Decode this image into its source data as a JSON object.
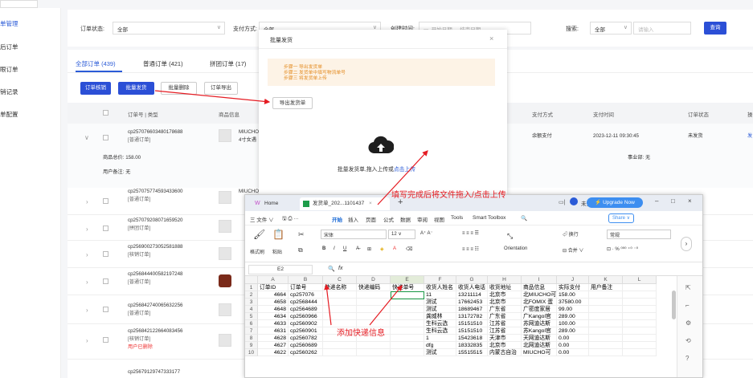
{
  "sidebar": {
    "items": [
      {
        "label": "单管理",
        "active": true
      },
      {
        "label": "后订单"
      },
      {
        "label": "眼订单"
      },
      {
        "label": "销记录"
      },
      {
        "label": "单配置"
      }
    ]
  },
  "filters": {
    "order_status_label": "订单状态:",
    "order_status_value": "全部",
    "pay_method_label": "支付方式:",
    "pay_method_value": "全部",
    "created_time_label": "创建时间:",
    "start_date_placeholder": "开始日期",
    "date_sep": "-",
    "end_date_placeholder": "结束日期",
    "search_label": "搜索:",
    "search_scope_value": "全部",
    "search_placeholder": "请输入",
    "query_button": "查询"
  },
  "tabs": [
    {
      "label": "全部订单 (439)",
      "active": true
    },
    {
      "label": "普通订单 (421)"
    },
    {
      "label": "拼团订单 (17)"
    }
  ],
  "actions": {
    "verify": "订单核销",
    "batch_ship": "批量发货",
    "batch_delete": "批量删除",
    "export": "订单导出"
  },
  "table": {
    "headers": [
      "订单号 | 类型",
      "商品信息",
      "支付方式",
      "支付时间",
      "订单状态",
      "操"
    ],
    "first_row": {
      "order_no": "cp257076603480178688",
      "type": "[普通订单]",
      "product": "MIUCHO",
      "product_sub": "4寸女遇",
      "pay_method": "余额支付",
      "pay_time": "2023-12-11 09:30:45",
      "status": "未发货",
      "op": "发"
    },
    "first_detail": {
      "total_label": "商品总价: 158.00",
      "remark_label": "用户备注: 无",
      "dept_label": "事业部: 无"
    },
    "rows": [
      {
        "order_no": "cp257075774593433600",
        "type": "[普通订单]",
        "product": "MIUCHO",
        "extra": ""
      },
      {
        "order_no": "cp257079208071659520",
        "type": "[拼团订单]",
        "product": "",
        "extra": ""
      },
      {
        "order_no": "cp256900273052581888",
        "type": "[核销订单]",
        "product": "",
        "extra": ""
      },
      {
        "order_no": "cp256844400582197248",
        "type": "[普通订单]",
        "product": "",
        "extra": ""
      },
      {
        "order_no": "cp256842740065632256",
        "type": "[普通订单]",
        "product": "",
        "extra": ""
      },
      {
        "order_no": "cp256842122664083456",
        "type": "[核销订单]",
        "product": "",
        "extra": "用户已删除"
      },
      {
        "order_no": "cp25679129747333177",
        "type": "",
        "product": "",
        "extra": ""
      }
    ]
  },
  "dialog": {
    "title": "批量发货",
    "steps": [
      "步骤一 导出发货单",
      "步骤二 发货单中填写物流单号",
      "步骤三 将发货单上传"
    ],
    "export_button": "导出发货单",
    "upload_text": "批量发货单,拖入上传或",
    "upload_link": "点击上传"
  },
  "annotations": {
    "fill_upload": "填写完成后将文件拖入/点击上传",
    "add_express": "添加快递信息"
  },
  "excel": {
    "home_tab": "Home",
    "file_tab": "发货单_202...1101437",
    "not_logged": "未登录",
    "upgrade": "Upgrade Now",
    "menus": [
      "三 文件 ∨",
      "开始",
      "插入",
      "页面",
      "公式",
      "数据",
      "审阅",
      "视图",
      "Tools",
      "Smart Toolbox"
    ],
    "share": "Share",
    "ribbon": {
      "format_painter": "格式刷",
      "paste": "粘贴",
      "font": "宋体",
      "font_size": "12",
      "wrap": "换行",
      "merge": "合并",
      "orientation": "Orientation",
      "number_format": "常规"
    },
    "name_box": "E2",
    "fx": "fx",
    "columns": [
      "A",
      "B",
      "C",
      "D",
      "E",
      "F",
      "G",
      "H",
      "I",
      "J",
      "K",
      "L"
    ],
    "header_row": [
      "订单ID",
      "订单号",
      "快递名称",
      "快递编码",
      "快递单号",
      "收货人姓名",
      "收货人电话",
      "收货地址",
      "商品信息",
      "实际支付",
      "用户备注",
      ""
    ],
    "rows": [
      {
        "n": "2",
        "cells": [
          "4664",
          "cp257076",
          "",
          "",
          "",
          "11",
          "13211114",
          "北京市",
          "北MIUCHO可",
          "158.00",
          "",
          ""
        ]
      },
      {
        "n": "3",
        "cells": [
          "4658",
          "cp2568444",
          "",
          "",
          "",
          "测试",
          "17662453",
          "北京市",
          "北FOMIX 蛋",
          "37580.00",
          "",
          ""
        ]
      },
      {
        "n": "4",
        "cells": [
          "4648",
          "cp2564689",
          "",
          "",
          "",
          "测试",
          "18689467",
          "广东省",
          "广密度家居",
          "99.00",
          "",
          ""
        ]
      },
      {
        "n": "5",
        "cells": [
          "4634",
          "cp2560966",
          "",
          "",
          "",
          "龚威林",
          "13172782",
          "广东省",
          "广Kangol官",
          "289.00",
          "",
          ""
        ]
      },
      {
        "n": "6",
        "cells": [
          "4633",
          "cp2560902",
          "",
          "",
          "",
          "生科云选",
          "15151510",
          "江苏省",
          "苏网迪达斯",
          "100.00",
          "",
          ""
        ]
      },
      {
        "n": "7",
        "cells": [
          "4631",
          "cp2560901",
          "",
          "",
          "",
          "生科云选",
          "15151510",
          "江苏省",
          "苏Kangol官",
          "289.00",
          "",
          ""
        ]
      },
      {
        "n": "8",
        "cells": [
          "4628",
          "cp2560782",
          "",
          "",
          "",
          "1",
          "15423618",
          "天津市",
          "天网迪达斯",
          "0.00",
          "",
          ""
        ]
      },
      {
        "n": "9",
        "cells": [
          "4627",
          "cp2560689",
          "",
          "",
          "",
          "dfg",
          "18332835",
          "北京市",
          "北网迪达斯",
          "0.00",
          "",
          ""
        ]
      },
      {
        "n": "10",
        "cells": [
          "4622",
          "cp2560262",
          "",
          "",
          "",
          "测试",
          "15515515",
          "内蒙古自治",
          "MIUCHO可",
          "0.00",
          "",
          ""
        ]
      }
    ]
  },
  "colors": {
    "primary": "#2b4fd6",
    "annotation_red": "#e51c23",
    "step_orange": "#e38a1e"
  }
}
